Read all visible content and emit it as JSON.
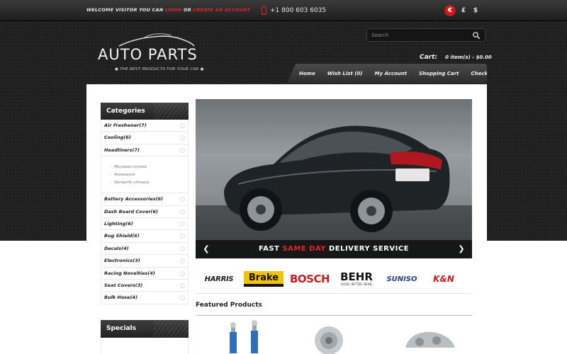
{
  "header": {
    "welcome_prefix": "WELCOME VISITOR YOU CAN",
    "login_label": "LOGIN",
    "or_text": "OR",
    "create_account_label": "CREATE AN ACCOUNT",
    "phone": "+1 800 603 6035",
    "currencies": [
      {
        "symbol": "€",
        "active": true
      },
      {
        "symbol": "£",
        "active": false
      },
      {
        "symbol": "$",
        "active": false
      }
    ],
    "accent_color": "#d7262f"
  },
  "logo": {
    "title": "AUTO PARTS",
    "tagline": "● THE BEST PRODUCTS FOR YOUR CAR ●"
  },
  "search": {
    "placeholder": "Search",
    "button_icon": "magnifier-icon"
  },
  "cart": {
    "label": "Cart:",
    "summary": "0 item(s) - $0.00"
  },
  "nav": {
    "items": [
      "Home",
      "Wish List (0)",
      "My Account",
      "Shopping Cart",
      "Checkout"
    ]
  },
  "sidebar": {
    "categories_title": "Categories",
    "categories_before": [
      "Air Freshener(7)",
      "Cooling(6)",
      "Headliners(7)"
    ],
    "subcategories": [
      "Muyasas luytase",
      "Aseeeasos",
      "Kertasrfe vitrasea"
    ],
    "categories_after": [
      "Battery Accessories(6)",
      "Dash Board Cover(6)",
      "Lighting(6)",
      "Bug Shield(6)",
      "Decals(4)",
      "Electronics(3)",
      "Racing Novelties(4)",
      "Seat Covers(3)",
      "Bulk Hose(4)"
    ],
    "specials_title": "Specials"
  },
  "slider": {
    "caption_before": "FAST ",
    "caption_highlight": "SAME DAY",
    "caption_after": " DELIVERY SERVICE",
    "prev_icon": "arrow-left-icon",
    "next_icon": "arrow-right-icon"
  },
  "brands": {
    "harris": "HARRIS",
    "brake": "Brake",
    "bosch": "BOSCH",
    "behr": "BEHR",
    "behr_sub": "GOOD. BETTER. BEHR.",
    "suniso": "SUNISO",
    "kn": "K&N"
  },
  "featured": {
    "title": "Featured Products"
  }
}
